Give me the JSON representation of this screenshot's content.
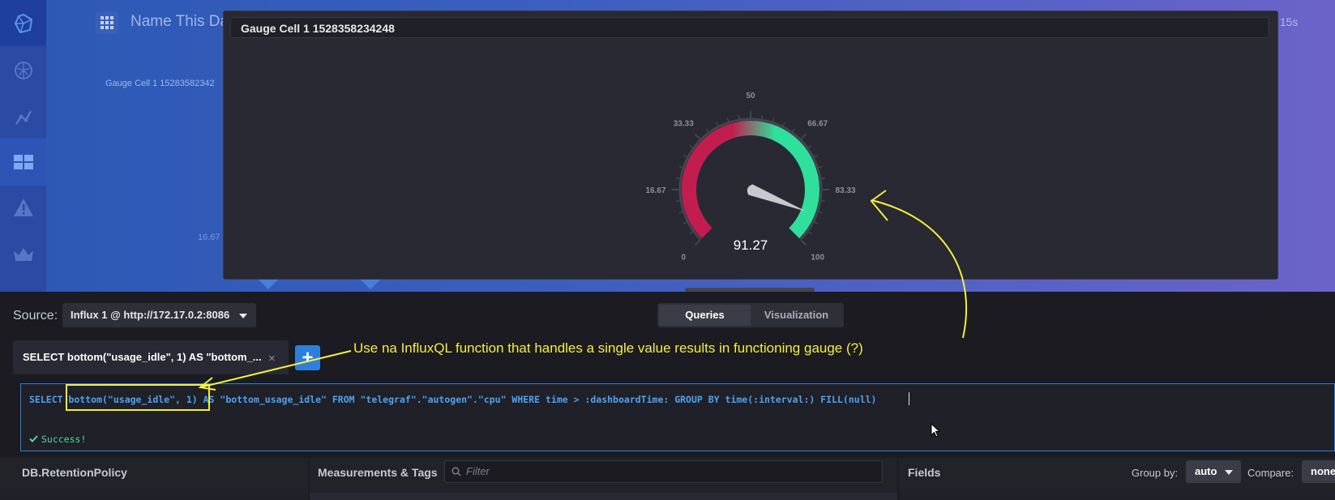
{
  "nav": {
    "items": [
      "logo",
      "host-list",
      "data-explorer",
      "dashboards",
      "alerting",
      "admin"
    ],
    "active": "dashboards"
  },
  "dashboard": {
    "title": "Name This Da",
    "refresh": "y 15s",
    "cell_name": "Gauge Cell 1 15283582342",
    "axis_label": "16.67"
  },
  "cell_editor": {
    "name": "Gauge Cell 1 1528358234248",
    "gauge": {
      "value": 91.27,
      "value_label": "91.27",
      "min": 0,
      "max": 100,
      "tick_labels": [
        "0",
        "16.67",
        "33.33",
        "50",
        "66.67",
        "83.33",
        "100"
      ],
      "colors": {
        "low": "#c31d4f",
        "high": "#2fdf9b",
        "track": "#45454f",
        "needle": "#d9d9e0"
      }
    }
  },
  "source": {
    "label": "Source:",
    "selected": "Influx 1 @ http://172.17.0.2:8086"
  },
  "toggle": {
    "queries": "Queries",
    "visualization": "Visualization",
    "active": "queries"
  },
  "query_tab": {
    "label": "SELECT bottom(\"usage_idle\", 1) AS \"bottom_...",
    "close": "×",
    "add": "+"
  },
  "annotation": {
    "text": "Use na InfluxQL function that handles a single value results in functioning gauge (?)",
    "color": "#f6ef3c"
  },
  "query": {
    "text": "SELECT bottom(\"usage_idle\", 1) AS \"bottom_usage_idle\" FROM \"telegraf\".\"autogen\".\"cpu\" WHERE time > :dashboardTime: GROUP BY time(:interval:) FILL(null)",
    "status": "Success!"
  },
  "bottom": {
    "db_header": "DB.RetentionPolicy",
    "measurements_header": "Measurements & Tags",
    "filter_placeholder": "Filter",
    "fields_header": "Fields",
    "group_by_label": "Group by:",
    "group_by_value": "auto",
    "compare_label": "Compare:",
    "compare_value": "none"
  }
}
